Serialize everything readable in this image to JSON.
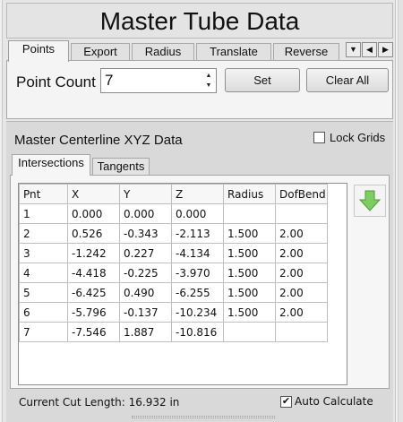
{
  "title": "Master Tube Data",
  "tabs": [
    "Points",
    "Export",
    "Radius",
    "Translate",
    "Reverse"
  ],
  "tab_nav_icons": [
    "chevron-down-icon",
    "chevron-left-icon",
    "chevron-right-icon"
  ],
  "points": {
    "count_label": "Point Count",
    "count_value": "7",
    "set_label": "Set",
    "clear_label": "Clear All"
  },
  "section": {
    "title": "Master Centerline XYZ Data",
    "lock_label": "Lock Grids",
    "lock_checked": false,
    "sub_tabs": [
      "Intersections",
      "Tangents"
    ]
  },
  "grid": {
    "columns": [
      "Pnt",
      "X",
      "Y",
      "Z",
      "Radius",
      "DofBend"
    ],
    "rows": [
      [
        "1",
        "0.000",
        "0.000",
        "0.000",
        "",
        ""
      ],
      [
        "2",
        "0.526",
        "-0.343",
        "-2.113",
        "1.500",
        "2.00"
      ],
      [
        "3",
        "-1.242",
        "0.227",
        "-4.134",
        "1.500",
        "2.00"
      ],
      [
        "4",
        "-4.418",
        "-0.225",
        "-3.970",
        "1.500",
        "2.00"
      ],
      [
        "5",
        "-6.425",
        "0.490",
        "-6.255",
        "1.500",
        "2.00"
      ],
      [
        "6",
        "-5.796",
        "-0.137",
        "-10.234",
        "1.500",
        "2.00"
      ],
      [
        "7",
        "-7.546",
        "1.887",
        "-10.816",
        "",
        ""
      ]
    ]
  },
  "status": {
    "cut_length": "Current Cut Length:  16.932 in",
    "auto_label": "Auto Calculate",
    "auto_checked": true
  },
  "colors": {
    "arrow_green": "#7ccf5f"
  }
}
